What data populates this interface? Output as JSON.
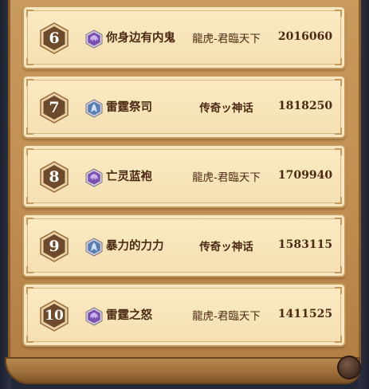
{
  "leaderboard": {
    "rows": [
      {
        "rank": "6",
        "class_icon": "warlock-icon",
        "name": "你身边有内鬼",
        "guild": "龍虎-君臨天下",
        "score": "2016060"
      },
      {
        "rank": "7",
        "class_icon": "shaman-icon",
        "name": "雷霆祭司",
        "guild": "传奇ッ神话",
        "score": "1818250"
      },
      {
        "rank": "8",
        "class_icon": "warlock-icon",
        "name": "亡灵蓝袍",
        "guild": "龍虎-君臨天下",
        "score": "1709940"
      },
      {
        "rank": "9",
        "class_icon": "shaman-icon",
        "name": "暴力的力力",
        "guild": "传奇ッ神话",
        "score": "1583115"
      },
      {
        "rank": "10",
        "class_icon": "warlock-icon",
        "name": "雷霆之怒",
        "guild": "龍虎-君臨天下",
        "score": "1411525"
      }
    ]
  },
  "colors": {
    "warlock_icon": "#7a4fb0",
    "shaman_icon": "#5b7fb0",
    "badge_fill": "#6e4a2c",
    "badge_border": "#e9d3a6",
    "text": "#4a2a12"
  }
}
